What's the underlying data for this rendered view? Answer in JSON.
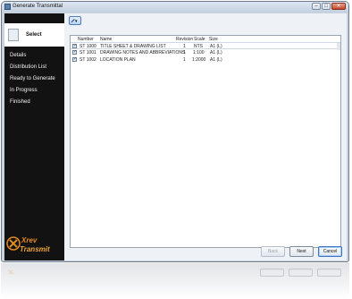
{
  "window": {
    "title": "Generate Transmittal"
  },
  "sidebar": {
    "active_step": "Select",
    "steps": [
      "Details",
      "Distribution List",
      "Ready to Generate",
      "In Progress",
      "Finished"
    ],
    "logo": {
      "primary": "Xrev",
      "secondary": "Transmit"
    }
  },
  "grid": {
    "columns": [
      "Number",
      "Name",
      "Revision",
      "Scale",
      "Size"
    ],
    "rows": [
      {
        "checked": true,
        "number": "ST 1000",
        "name": "TITLE SHEET & DRAWING LIST",
        "revision": "1",
        "scale": "NTS",
        "size": "A1 (L)"
      },
      {
        "checked": true,
        "number": "ST 1001",
        "name": "DRAWING NOTES AND ABBREVIATIONS",
        "revision": "1",
        "scale": "1:100",
        "size": "A1 (L)"
      },
      {
        "checked": true,
        "number": "ST 1002",
        "name": "LOCATION PLAN",
        "revision": "1",
        "scale": "1:2000",
        "size": "A1 (L)"
      }
    ]
  },
  "buttons": {
    "back": "Back",
    "next": "Next",
    "cancel": "Cancel"
  },
  "colors": {
    "sidebar_bg": "#121212",
    "accent": "#3b74c3",
    "logo_orange": "#e08a1e"
  },
  "icons": {
    "toolbar": "pencil-dropdown-icon",
    "step": "document-icon"
  }
}
